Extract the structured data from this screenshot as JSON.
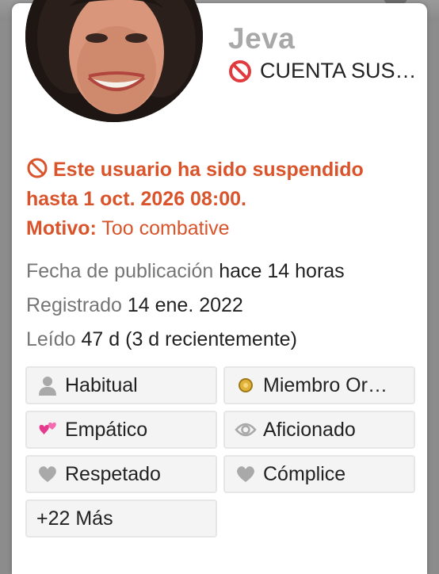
{
  "user": {
    "username": "Jeva",
    "status": "CUENTA SUS…"
  },
  "suspension": {
    "message": "Este usuario ha sido suspendido hasta 1 oct. 2026 08:00.",
    "reason_label": "Motivo:",
    "reason_value": "Too combative"
  },
  "meta": [
    {
      "label": "Fecha de publicación",
      "value": "hace 14 horas"
    },
    {
      "label": "Registrado",
      "value": "14 ene. 2022"
    },
    {
      "label": "Leído",
      "value": "47 d (3 d recientemente)"
    }
  ],
  "badges": [
    {
      "label": "Habitual",
      "icon": "person-icon"
    },
    {
      "label": "Miembro Or…",
      "icon": "gold-badge-icon"
    },
    {
      "label": "Empático",
      "icon": "two-hearts-icon"
    },
    {
      "label": "Aficionado",
      "icon": "eye-icon"
    },
    {
      "label": "Respetado",
      "icon": "heart-icon"
    },
    {
      "label": "Cómplice",
      "icon": "heart-icon"
    },
    {
      "label": "+22 Más",
      "icon": ""
    }
  ],
  "colors": {
    "accent": "#d9542b",
    "muted": "#757575",
    "badge_bg": "#f4f4f4"
  }
}
